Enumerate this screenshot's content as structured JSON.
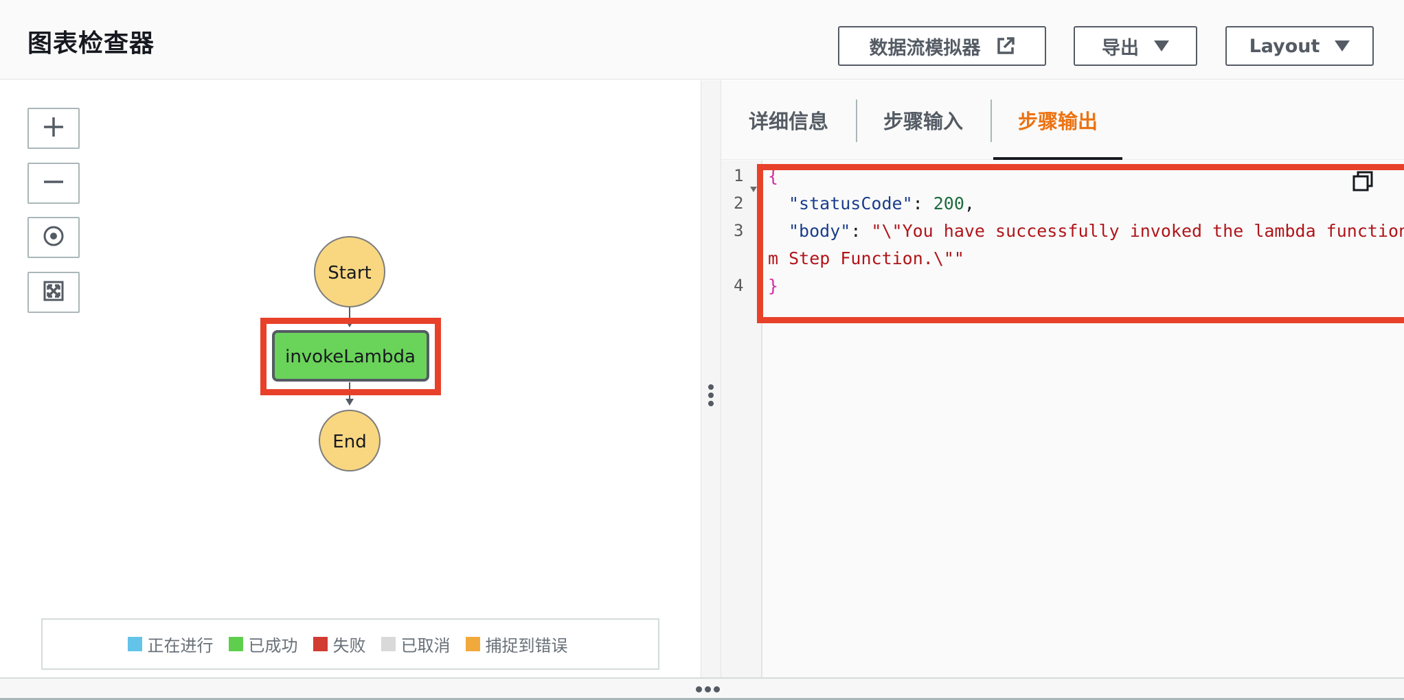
{
  "header": {
    "title": "图表检查器",
    "simulator_label": "数据流模拟器",
    "export_label": "导出",
    "layout_label": "Layout"
  },
  "graph": {
    "nodes": {
      "start": "Start",
      "task": "invokeLambda",
      "end": "End"
    },
    "colors": {
      "start_end_fill": "#f9d781",
      "task_fill": "#6ad35a",
      "highlight": "#e8412a"
    }
  },
  "legend": {
    "items": [
      {
        "label": "正在进行",
        "color": "#63c3e8"
      },
      {
        "label": "已成功",
        "color": "#5fce4d"
      },
      {
        "label": "失败",
        "color": "#d13b32"
      },
      {
        "label": "已取消",
        "color": "#d9d9d9"
      },
      {
        "label": "捕捉到错误",
        "color": "#f2a93b"
      }
    ]
  },
  "tabs": {
    "details": "详细信息",
    "input": "步骤输入",
    "output": "步骤输出"
  },
  "editor": {
    "line_numbers": [
      "1",
      "2",
      "3",
      "4"
    ],
    "open_brace": "{",
    "status_key": "\"statusCode\"",
    "status_colon": ": ",
    "status_value": "200",
    "status_comma": ",",
    "body_key": "\"body\"",
    "body_colon": ": ",
    "body_value_part1": "\"\\\"You have successfully invoked the lambda function f",
    "body_value_part2": "m Step Function.\\\"\"",
    "close_brace": "}"
  }
}
